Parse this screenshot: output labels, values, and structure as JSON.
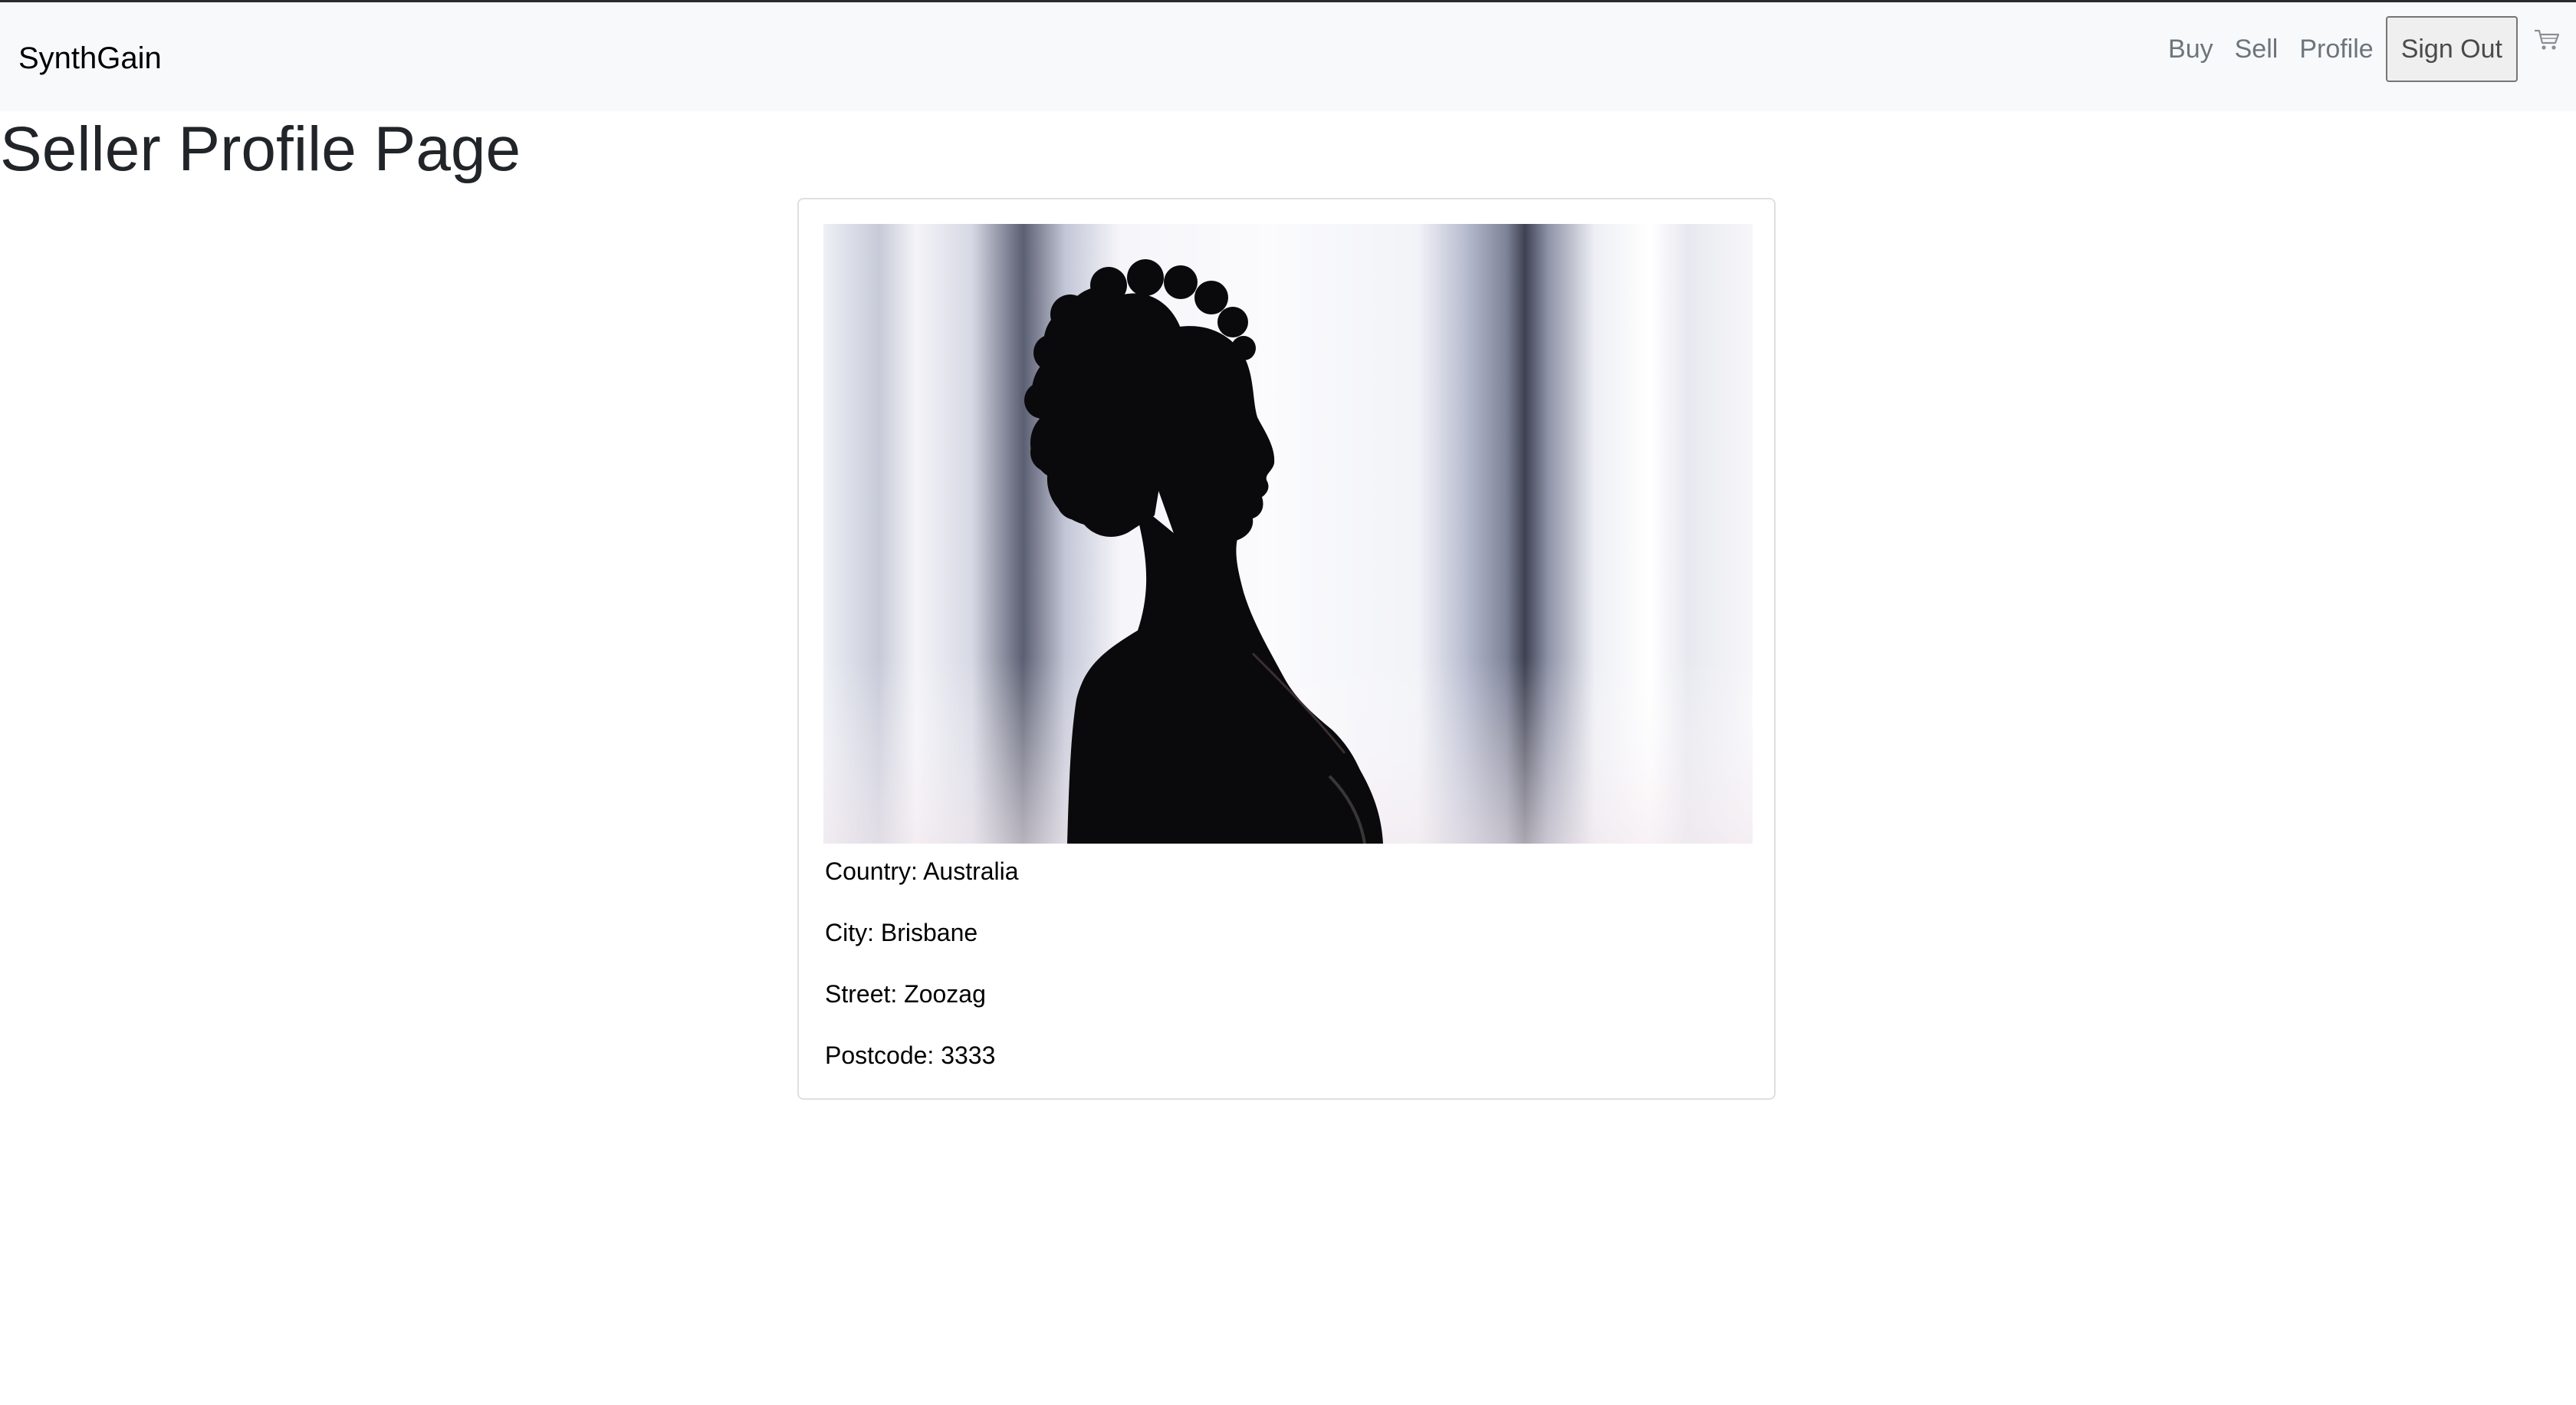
{
  "navbar": {
    "brand": "SynthGain",
    "links": [
      "Buy",
      "Sell",
      "Profile"
    ],
    "sign_out_label": "Sign Out",
    "cart_icon": "cart-icon"
  },
  "page": {
    "title": "Seller Profile Page"
  },
  "profile": {
    "image_alt": "",
    "country": "Country: Australia",
    "city": "City: Brisbane",
    "street": "Street: Zoozag",
    "postcode": "Postcode: 3333"
  },
  "colors": {
    "navbar_bg": "#f8f9fa",
    "nav_link": "#6c757d",
    "card_border": "#dfdfdf"
  }
}
